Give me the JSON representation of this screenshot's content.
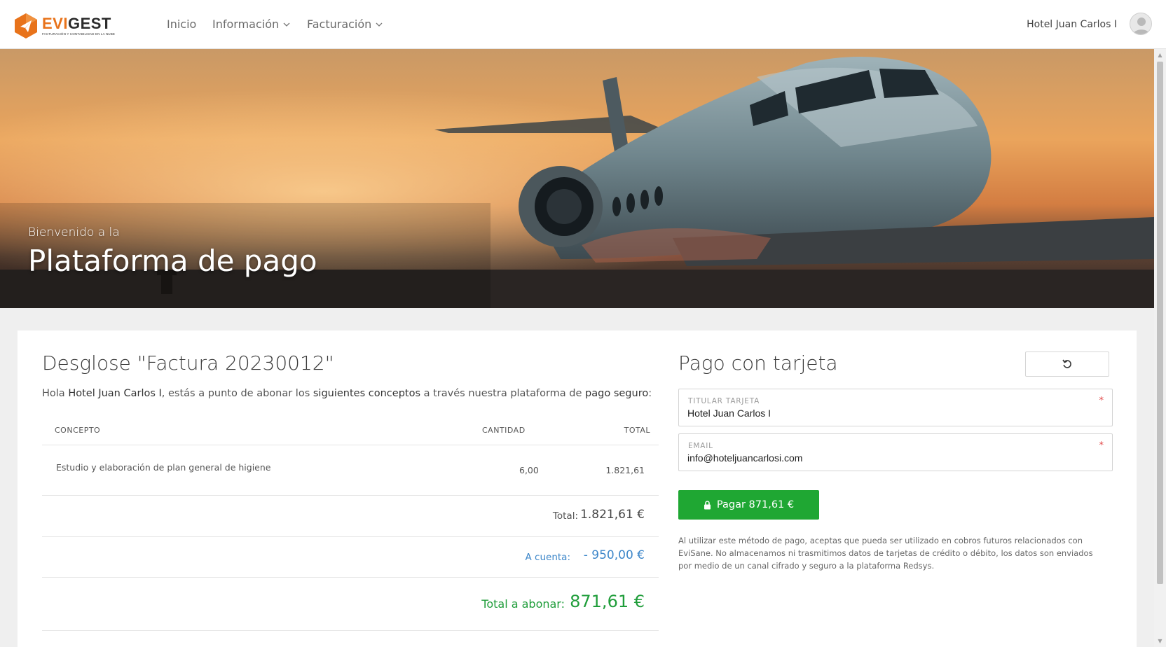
{
  "brand": {
    "name_part1": "EVI",
    "name_part2": "GEST",
    "tagline": "FACTURACIÓN Y CONTABILIDAD EN LA NUBE"
  },
  "nav": {
    "items": [
      {
        "label": "Inicio"
      },
      {
        "label": "Información"
      },
      {
        "label": "Facturación"
      }
    ]
  },
  "user": {
    "name": "Hotel Juan Carlos I"
  },
  "hero": {
    "subtitle": "Bienvenido a la",
    "title": "Plataforma de pago"
  },
  "breakdown": {
    "title": "Desglose \"Factura 20230012\"",
    "intro": {
      "p1": "Hola ",
      "b1": "Hotel Juan Carlos I",
      "p2": ", estás a punto de abonar los ",
      "b2": "siguientes conceptos",
      "p3": " a través nuestra plataforma de ",
      "b3": "pago seguro",
      "p4": ":"
    },
    "columns": [
      "CONCEPTO",
      "CANTIDAD",
      "TOTAL"
    ],
    "rows": [
      {
        "concepto": "Estudio y elaboración de plan general de higiene",
        "cantidad": "6,00",
        "total": "1.821,61"
      }
    ],
    "total_label": "Total:",
    "total_value": "1.821,61 €",
    "cuenta_label": "A cuenta:",
    "cuenta_value": "- 950,00 €",
    "abonar_label": "Total a abonar:",
    "abonar_value": "871,61 €"
  },
  "payment": {
    "title": "Pago con tarjeta",
    "holder_label": "TITULAR TARJETA",
    "holder_value": "Hotel Juan Carlos I",
    "email_label": "EMAIL",
    "email_value": "info@hoteljuancarlosi.com",
    "required_mark": "*",
    "pay_button": "Pagar 871,61 €",
    "disclaimer": "Al utilizar este método de pago, aceptas que pueda ser utilizado en cobros futuros relacionados con EviSane. No almacenamos ni trasmitimos datos de tarjetas de crédito o débito, los datos son enviados por medio de un canal cifrado y seguro a la plataforma Redsys."
  },
  "colors": {
    "brand_orange": "#e8731b",
    "pay_green": "#1fa733",
    "link_blue": "#3c86c9",
    "total_green": "#1f9d3a"
  },
  "icons": [
    "logo-hex-icon",
    "chevron-down-icon",
    "user-avatar-icon",
    "refresh-icon",
    "lock-icon"
  ]
}
